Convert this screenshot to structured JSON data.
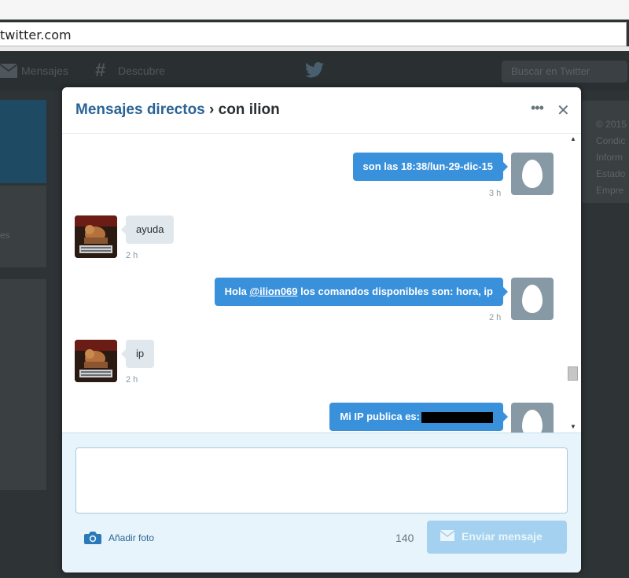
{
  "browser": {
    "url": "twitter.com"
  },
  "nav": {
    "messages_label": "Mensajes",
    "discover_label": "Descubre",
    "search_placeholder": "Buscar en Twitter"
  },
  "sidebar_right": {
    "lines": [
      "© 2015",
      "Condic",
      "Inform",
      "Estado",
      "Empre"
    ]
  },
  "sidebar_left": {
    "fragment": "es"
  },
  "modal": {
    "title_link": "Mensajes directos",
    "title_rest": " › con ilion",
    "more_icon": "more-dots-icon",
    "close_icon": "close-icon"
  },
  "messages": [
    {
      "direction": "outgoing",
      "text": "son las 18:38/lun-29-dic-15",
      "time": "3 h"
    },
    {
      "direction": "incoming",
      "text": "ayuda",
      "time": "2 h"
    },
    {
      "direction": "outgoing",
      "prefix": "Hola ",
      "mention": "@ilion069",
      "suffix": " los comandos disponibles son: hora, ip",
      "time": "2 h"
    },
    {
      "direction": "incoming",
      "text": "ip",
      "time": "2 h"
    },
    {
      "direction": "outgoing",
      "text": "Mi IP publica es:",
      "redacted": true
    }
  ],
  "composer": {
    "text_value": "",
    "add_photo_label": "Añadir foto",
    "char_count": "140",
    "send_label": "Enviar mensaje"
  },
  "colors": {
    "accent": "#3a91db",
    "link": "#2a6496",
    "send_disabled": "#a3d1ef",
    "incoming_bubble": "#e1e8ed"
  }
}
